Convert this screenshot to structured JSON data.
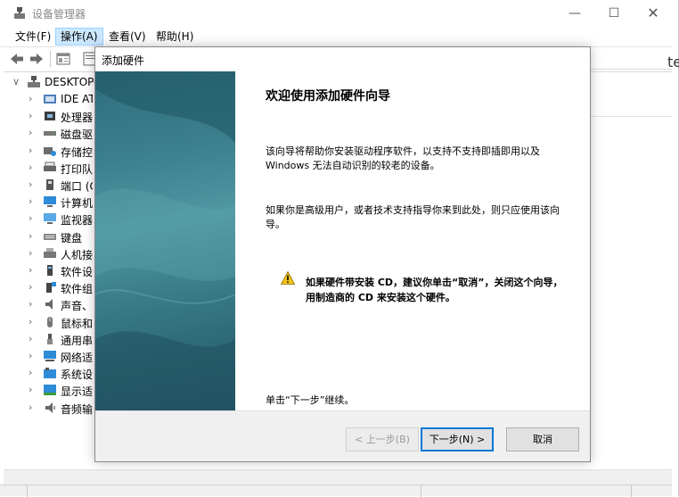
{
  "window": {
    "title": "设备管理器",
    "controls": {
      "minimize": "—",
      "maximize": "☐",
      "close": "✕"
    }
  },
  "menu": {
    "file": "文件(F)",
    "action": "操作(A)",
    "view": "查看(V)",
    "help": "帮助(H)"
  },
  "tree": {
    "root": "DESKTOP-",
    "items": [
      {
        "label": "IDE AT",
        "icon": "ide-controller-icon"
      },
      {
        "label": "处理器",
        "icon": "processor-icon"
      },
      {
        "label": "磁盘驱",
        "icon": "disk-drive-icon"
      },
      {
        "label": "存储控",
        "icon": "storage-controller-icon"
      },
      {
        "label": "打印队列",
        "icon": "printer-icon"
      },
      {
        "label": "端口 (C",
        "icon": "port-icon"
      },
      {
        "label": "计算机",
        "icon": "computer-icon"
      },
      {
        "label": "监视器",
        "icon": "monitor-icon"
      },
      {
        "label": "键盘",
        "icon": "keyboard-icon"
      },
      {
        "label": "人机接",
        "icon": "hid-icon"
      },
      {
        "label": "软件设",
        "icon": "software-device-icon"
      },
      {
        "label": "软件组",
        "icon": "software-component-icon"
      },
      {
        "label": "声音、",
        "icon": "sound-icon"
      },
      {
        "label": "鼠标和",
        "icon": "mouse-icon"
      },
      {
        "label": "通用串",
        "icon": "usb-icon"
      },
      {
        "label": "网络适",
        "icon": "network-adapter-icon"
      },
      {
        "label": "系统设",
        "icon": "system-device-icon"
      },
      {
        "label": "显示适",
        "icon": "display-adapter-icon"
      },
      {
        "label": "音频输",
        "icon": "audio-io-icon"
      }
    ],
    "right_edge_char": "te"
  },
  "dialog": {
    "title": "添加硬件",
    "heading": "欢迎使用添加硬件向导",
    "para1": "该向导将帮助你安装驱动程序软件，以支持不支持即插即用以及 Windows 无法自动识别的较老的设备。",
    "para2": "如果你是高级用户，或者技术支持指导你来到此处，则只应使用该向导。",
    "warning": "如果硬件带安装 CD，建议你单击“取消”，关闭这个向导，用制造商的 CD 来安装这个硬件。",
    "continue": "单击“下一步”继续。",
    "buttons": {
      "back": "< 上一步(B)",
      "next": "下一步(N) >",
      "cancel": "取消"
    }
  },
  "colors": {
    "accent": "#0078d7",
    "menu_highlight": "#cce8ff",
    "sidebar_teal": "#3c7f8d"
  }
}
